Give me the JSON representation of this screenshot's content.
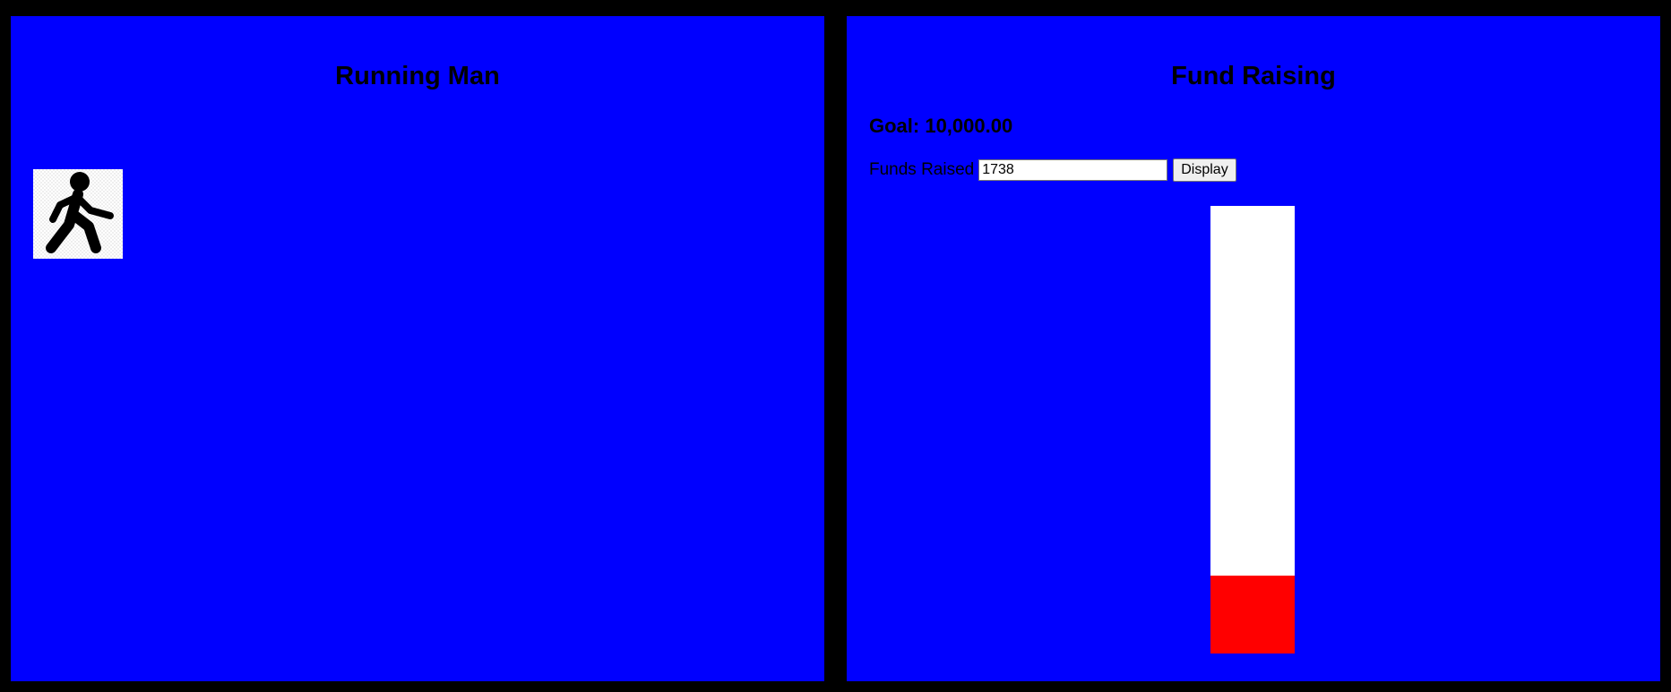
{
  "left_panel": {
    "title": "Running Man",
    "icon": "walking-man-icon"
  },
  "right_panel": {
    "title": "Fund Raising",
    "goal_text": "Goal: 10,000.00",
    "goal_value": 10000,
    "funds_label": "Funds Raised",
    "funds_value": "1738",
    "display_button_label": "Display",
    "progress_fraction": 0.1738
  },
  "colors": {
    "background": "#000000",
    "panel": "#0000ff",
    "thermometer_empty": "#ffffff",
    "thermometer_fill": "#ff0000"
  }
}
